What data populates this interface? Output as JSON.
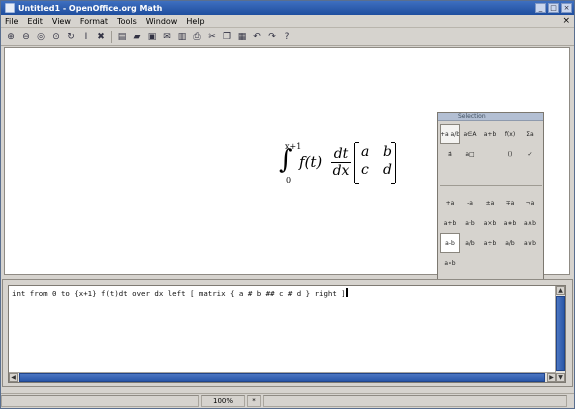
{
  "window": {
    "title": "Untitled1 - OpenOffice.org Math"
  },
  "menubar": {
    "items": [
      "File",
      "Edit",
      "View",
      "Format",
      "Tools",
      "Window",
      "Help"
    ]
  },
  "toolbar": {
    "icons": [
      "zoom-in-icon",
      "zoom-out-icon",
      "zoom-100-icon",
      "show-all-icon",
      "refresh-icon",
      "formula-cursor-icon",
      "symbols-icon",
      "new-icon",
      "open-icon",
      "save-icon",
      "email-icon",
      "pdf-icon",
      "print-icon",
      "cut-icon",
      "copy-icon",
      "paste-icon",
      "undo-icon",
      "redo-icon",
      "help-icon"
    ]
  },
  "formula": {
    "upper_limit": "x+1",
    "lower_limit": "0",
    "function": "f(t)",
    "fraction_num": "dt",
    "fraction_den": "dx",
    "matrix": [
      "a",
      "b",
      "c",
      "d"
    ]
  },
  "selection": {
    "title": "Selection",
    "categories": [
      "+a a/b",
      "a∈A",
      "a+b",
      "f(x)",
      "Σa",
      "a⃗",
      "a□",
      "",
      "()",
      "✓"
    ],
    "operators": [
      "+a",
      "-a",
      "±a",
      "∓a",
      "¬a",
      "a+b",
      "a·b",
      "a×b",
      "a∗b",
      "a∧b",
      "a-b",
      "a/b",
      "a÷b",
      "a/b",
      "a∨b",
      "a∘b",
      "",
      "",
      "",
      ""
    ]
  },
  "command": {
    "text": "int from 0 to {x+1} f(t)dt over dx left [ matrix { a # b ## c # d } right ]"
  },
  "statusbar": {
    "zoom": "100%",
    "mode": "*"
  }
}
